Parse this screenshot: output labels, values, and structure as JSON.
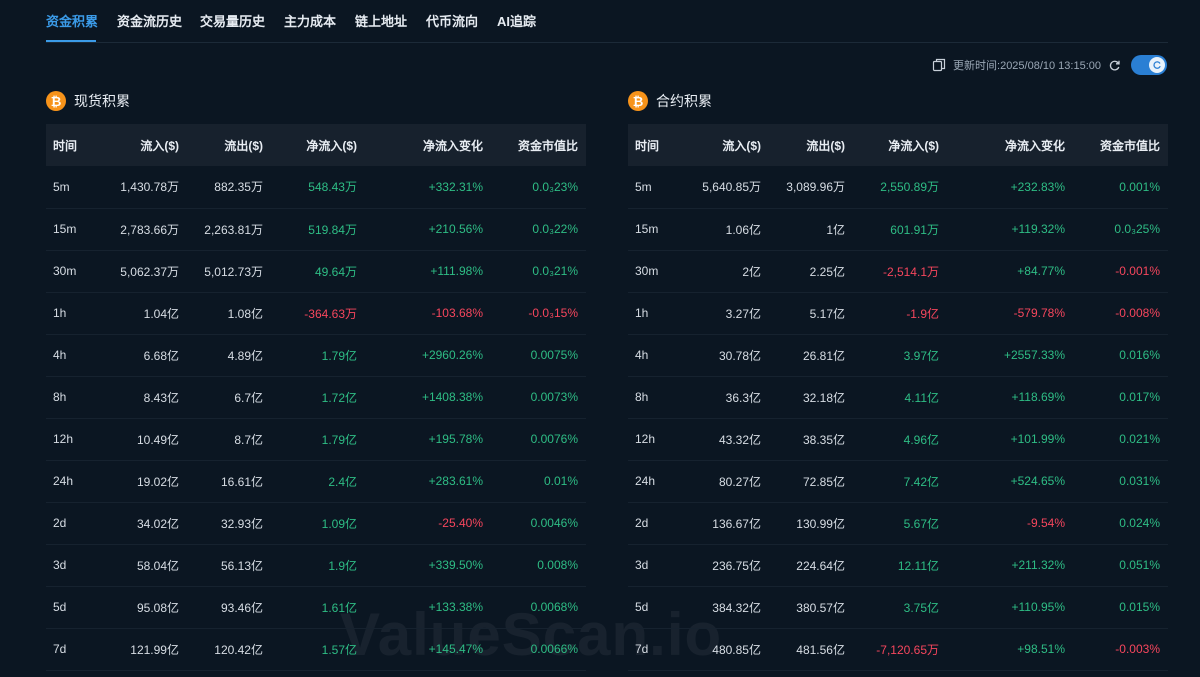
{
  "tabs": [
    "资金积累",
    "资金流历史",
    "交易量历史",
    "主力成本",
    "链上地址",
    "代币流向",
    "AI追踪"
  ],
  "update": {
    "text": "更新时间:2025/08/10 13:15:00"
  },
  "colors": {
    "accent": "#3b9be8",
    "positive": "#2ebd85",
    "negative": "#f6465d",
    "background": "#0b1622",
    "header": "#17212d",
    "btc": "#f7931a"
  },
  "icons": {
    "coin": "bitcoin-icon",
    "copy": "copy-icon",
    "refresh": "refresh-icon",
    "toggle": "toggle-switch"
  },
  "watermark": "ValueScan.io",
  "spot": {
    "title": "现货积累",
    "columns": [
      "时间",
      "流入($)",
      "流出($)",
      "净流入($)",
      "净流入变化",
      "资金市值比"
    ],
    "rows": [
      {
        "time": "5m",
        "inflow": "1,430.78万",
        "outflow": "882.35万",
        "net": "548.43万",
        "change": "+332.31%",
        "ratio": "0.0₃23%"
      },
      {
        "time": "15m",
        "inflow": "2,783.66万",
        "outflow": "2,263.81万",
        "net": "519.84万",
        "change": "+210.56%",
        "ratio": "0.0₃22%"
      },
      {
        "time": "30m",
        "inflow": "5,062.37万",
        "outflow": "5,012.73万",
        "net": "49.64万",
        "change": "+111.98%",
        "ratio": "0.0₃21%"
      },
      {
        "time": "1h",
        "inflow": "1.04亿",
        "outflow": "1.08亿",
        "net": "-364.63万",
        "change": "-103.68%",
        "ratio": "-0.0₃15%"
      },
      {
        "time": "4h",
        "inflow": "6.68亿",
        "outflow": "4.89亿",
        "net": "1.79亿",
        "change": "+2960.26%",
        "ratio": "0.0075%"
      },
      {
        "time": "8h",
        "inflow": "8.43亿",
        "outflow": "6.7亿",
        "net": "1.72亿",
        "change": "+1408.38%",
        "ratio": "0.0073%"
      },
      {
        "time": "12h",
        "inflow": "10.49亿",
        "outflow": "8.7亿",
        "net": "1.79亿",
        "change": "+195.78%",
        "ratio": "0.0076%"
      },
      {
        "time": "24h",
        "inflow": "19.02亿",
        "outflow": "16.61亿",
        "net": "2.4亿",
        "change": "+283.61%",
        "ratio": "0.01%"
      },
      {
        "time": "2d",
        "inflow": "34.02亿",
        "outflow": "32.93亿",
        "net": "1.09亿",
        "change": "-25.40%",
        "ratio": "0.0046%"
      },
      {
        "time": "3d",
        "inflow": "58.04亿",
        "outflow": "56.13亿",
        "net": "1.9亿",
        "change": "+339.50%",
        "ratio": "0.008%"
      },
      {
        "time": "5d",
        "inflow": "95.08亿",
        "outflow": "93.46亿",
        "net": "1.61亿",
        "change": "+133.38%",
        "ratio": "0.0068%"
      },
      {
        "time": "7d",
        "inflow": "121.99亿",
        "outflow": "120.42亿",
        "net": "1.57亿",
        "change": "+145.47%",
        "ratio": "0.0066%"
      }
    ]
  },
  "futures": {
    "title": "合约积累",
    "columns": [
      "时间",
      "流入($)",
      "流出($)",
      "净流入($)",
      "净流入变化",
      "资金市值比"
    ],
    "rows": [
      {
        "time": "5m",
        "inflow": "5,640.85万",
        "outflow": "3,089.96万",
        "net": "2,550.89万",
        "change": "+232.83%",
        "ratio": "0.001%"
      },
      {
        "time": "15m",
        "inflow": "1.06亿",
        "outflow": "1亿",
        "net": "601.91万",
        "change": "+119.32%",
        "ratio": "0.0₃25%"
      },
      {
        "time": "30m",
        "inflow": "2亿",
        "outflow": "2.25亿",
        "net": "-2,514.1万",
        "change": "+84.77%",
        "ratio": "-0.001%"
      },
      {
        "time": "1h",
        "inflow": "3.27亿",
        "outflow": "5.17亿",
        "net": "-1.9亿",
        "change": "-579.78%",
        "ratio": "-0.008%"
      },
      {
        "time": "4h",
        "inflow": "30.78亿",
        "outflow": "26.81亿",
        "net": "3.97亿",
        "change": "+2557.33%",
        "ratio": "0.016%"
      },
      {
        "time": "8h",
        "inflow": "36.3亿",
        "outflow": "32.18亿",
        "net": "4.11亿",
        "change": "+118.69%",
        "ratio": "0.017%"
      },
      {
        "time": "12h",
        "inflow": "43.32亿",
        "outflow": "38.35亿",
        "net": "4.96亿",
        "change": "+101.99%",
        "ratio": "0.021%"
      },
      {
        "time": "24h",
        "inflow": "80.27亿",
        "outflow": "72.85亿",
        "net": "7.42亿",
        "change": "+524.65%",
        "ratio": "0.031%"
      },
      {
        "time": "2d",
        "inflow": "136.67亿",
        "outflow": "130.99亿",
        "net": "5.67亿",
        "change": "-9.54%",
        "ratio": "0.024%"
      },
      {
        "time": "3d",
        "inflow": "236.75亿",
        "outflow": "224.64亿",
        "net": "12.11亿",
        "change": "+211.32%",
        "ratio": "0.051%"
      },
      {
        "time": "5d",
        "inflow": "384.32亿",
        "outflow": "380.57亿",
        "net": "3.75亿",
        "change": "+110.95%",
        "ratio": "0.015%"
      },
      {
        "time": "7d",
        "inflow": "480.85亿",
        "outflow": "481.56亿",
        "net": "-7,120.65万",
        "change": "+98.51%",
        "ratio": "-0.003%"
      }
    ]
  }
}
